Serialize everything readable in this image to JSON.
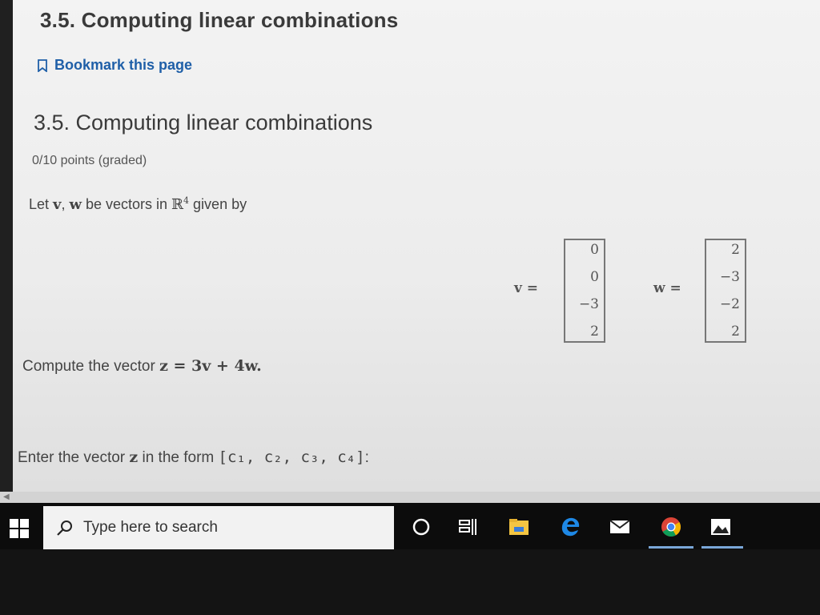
{
  "page": {
    "title": "3.5. Computing linear combinations",
    "bookmark_label": "Bookmark this page"
  },
  "problem": {
    "heading": "3.5. Computing linear combinations",
    "points": "0/10 points (graded)",
    "intro_prefix": "Let ",
    "intro_v": "v",
    "intro_comma": ", ",
    "intro_w": "w",
    "intro_mid": " be vectors in ",
    "intro_R": "ℝ",
    "intro_exp": "4",
    "intro_suffix": " given by",
    "v_label": "v =",
    "w_label": "w =",
    "v_values": [
      "0",
      "0",
      "−3",
      "2"
    ],
    "w_values": [
      "2",
      "−3",
      "−2",
      "2"
    ],
    "compute_prefix": "Compute the vector ",
    "compute_expr": "z = 3v + 4w.",
    "enter_prefix": "Enter the vector ",
    "enter_z": "z",
    "enter_mid": " in the form ",
    "enter_form": "[c₁, c₂, c₃, c₄]",
    "enter_suffix": ":"
  },
  "taskbar": {
    "search_placeholder": "Type here to search",
    "icons": [
      "windows-start-icon",
      "cortana-icon",
      "task-view-icon",
      "file-explorer-icon",
      "edge-icon",
      "mail-icon",
      "chrome-icon",
      "photos-icon"
    ]
  },
  "colors": {
    "link": "#1f5fa8",
    "text": "#444444",
    "taskbar": "#0c0c0c",
    "active_underline": "#7aa7d8"
  }
}
